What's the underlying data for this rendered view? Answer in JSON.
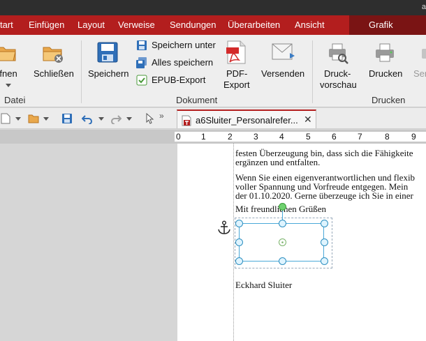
{
  "window": {
    "title_fragment": "a"
  },
  "menu": {
    "tabs": [
      {
        "label": "tart"
      },
      {
        "label": "Einfügen"
      },
      {
        "label": "Layout"
      },
      {
        "label": "Verweise"
      },
      {
        "label": "Sendungen"
      },
      {
        "label": "Überarbeiten"
      },
      {
        "label": "Ansicht"
      },
      {
        "label": "Grafik"
      }
    ]
  },
  "ribbon": {
    "datei": {
      "label": "Datei",
      "open": "ffnen",
      "close": "Schließen"
    },
    "dokument": {
      "label": "Dokument",
      "save": "Speichern",
      "save_as": "Speichern unter",
      "save_all": "Alles speichern",
      "epub": "EPUB-Export",
      "pdf_line1": "PDF-",
      "pdf_line2": "Export",
      "send": "Versenden"
    },
    "drucken": {
      "label": "Drucken",
      "preview_line1": "Druck-",
      "preview_line2": "vorschau",
      "print": "Drucken",
      "cut_label": "Ser"
    }
  },
  "document_tab": {
    "name": "a6Sluiter_Personalrefer...",
    "close": "✕"
  },
  "ruler": {
    "numbers": [
      "0",
      "1",
      "2",
      "3",
      "4",
      "5",
      "6",
      "7",
      "8",
      "9"
    ]
  },
  "document": {
    "lines": [
      "festen Überzeugung bin, dass sich die Fähigkeite",
      "ergänzen und entfalten.",
      "Wenn Sie einen eigenverantwortlichen und flexib",
      "voller Spannung und Vorfreude entgegen. Mein",
      "der 01.10.2020. Gerne überzeuge ich Sie in einer",
      "Mit freundlichen Grüßen",
      "Eckhard Sluiter"
    ]
  },
  "colors": {
    "accent": "#b31e1e",
    "selection": "#4aa8d8",
    "rotate_handle": "#6fd16f"
  }
}
